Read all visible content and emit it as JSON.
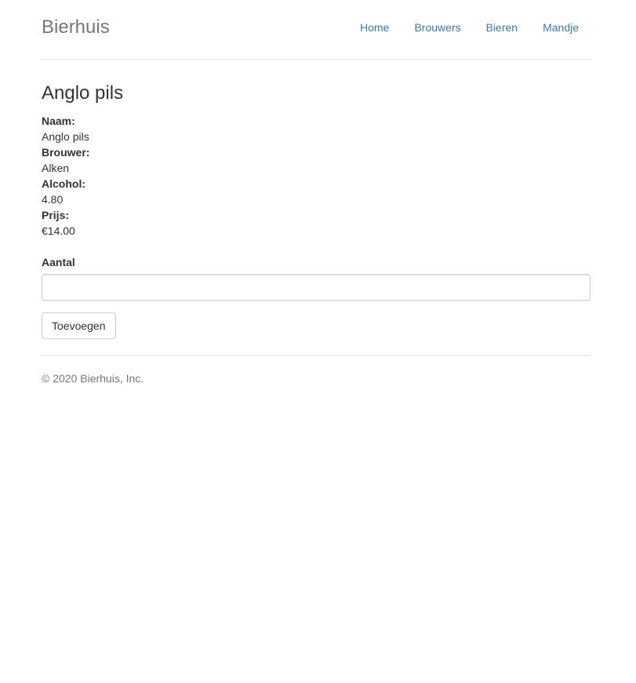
{
  "header": {
    "brand": "Bierhuis",
    "nav": [
      {
        "label": "Home"
      },
      {
        "label": "Brouwers"
      },
      {
        "label": "Bieren"
      },
      {
        "label": "Mandje"
      }
    ]
  },
  "main": {
    "title": "Anglo pils",
    "details": [
      {
        "label": "Naam:",
        "value": "Anglo pils"
      },
      {
        "label": "Brouwer:",
        "value": "Alken"
      },
      {
        "label": "Alcohol:",
        "value": "4.80"
      },
      {
        "label": "Prijs:",
        "value": "€14.00"
      }
    ],
    "form": {
      "quantity_label": "Aantal",
      "quantity_value": "",
      "submit_label": "Toevoegen"
    }
  },
  "footer": {
    "text": "© 2020 Bierhuis, Inc."
  },
  "colors": {
    "link": "#337ab7",
    "muted": "#777777",
    "text": "#333333",
    "border": "#e5e5e5"
  }
}
